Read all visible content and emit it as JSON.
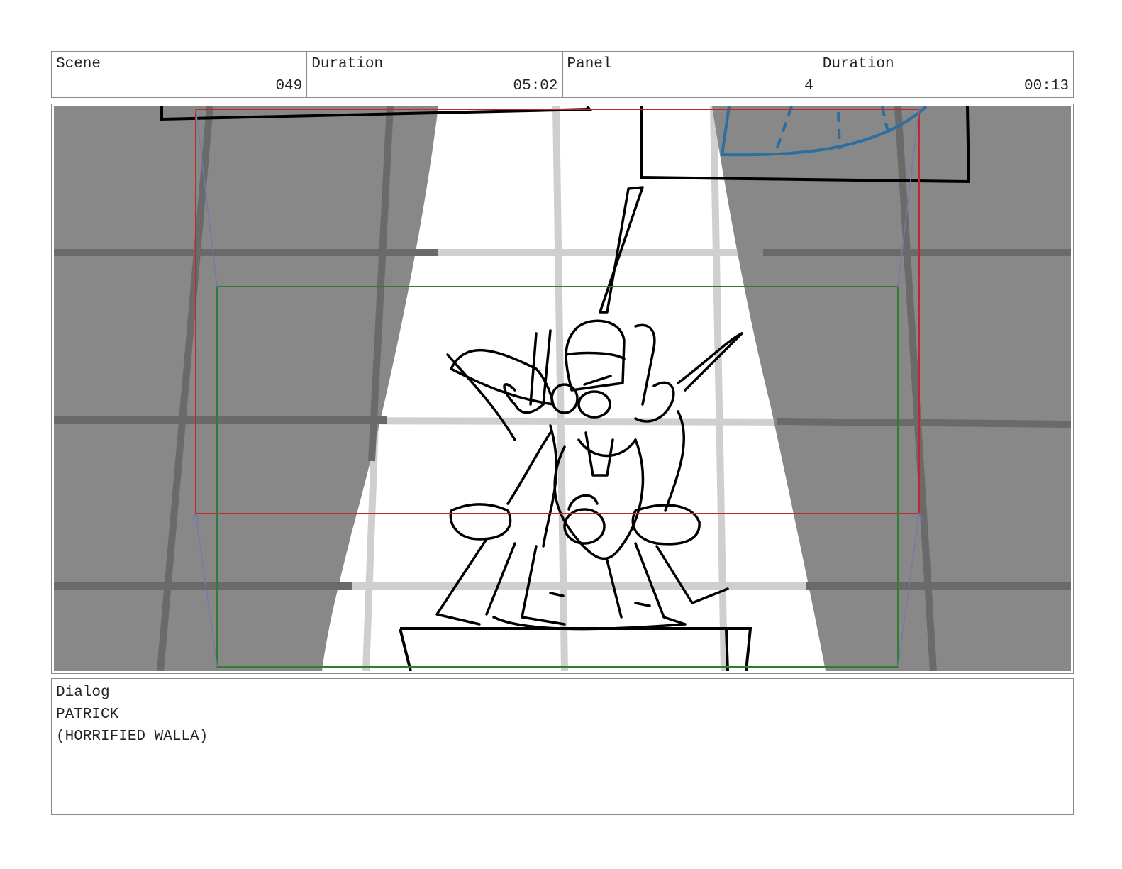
{
  "header": {
    "scene_label": "Scene",
    "scene_value": "049",
    "duration_label": "Duration",
    "duration_value": "05:02",
    "panel_label": "Panel",
    "panel_value": "4",
    "panel_duration_label": "Duration",
    "panel_duration_value": "00:13"
  },
  "dialog": {
    "label": "Dialog",
    "character": "PATRICK",
    "parenthetical": "(HORRIFIED WALLA)"
  },
  "colors": {
    "curtain": "#888888",
    "grid": "#6a6a6a",
    "safe_frame_red": "#c0282d",
    "safe_frame_green": "#2e7d32",
    "camera_arrow": "#7777aa",
    "prop_blue": "#2a6fa0"
  }
}
